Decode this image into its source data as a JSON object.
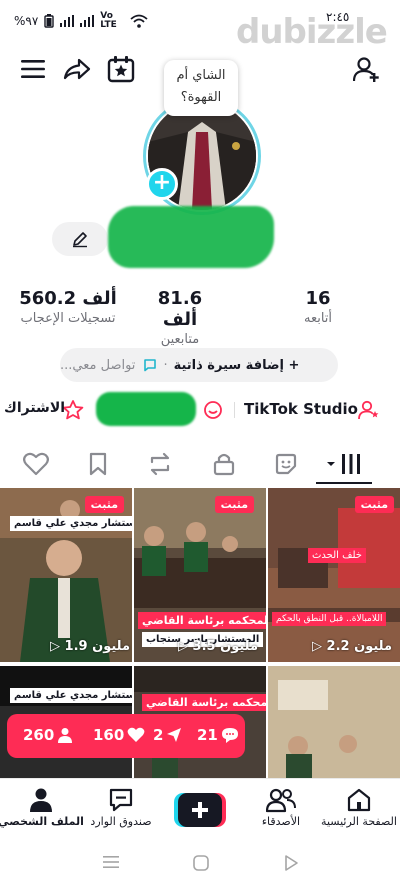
{
  "status": {
    "battery": "%٩٧",
    "network": "Vo LTE",
    "time": "٢:٤٥"
  },
  "watermark": "dubizzle",
  "profile": {
    "bubble": "الشاي أم القهوة؟",
    "stats": {
      "following": {
        "value": "16",
        "label": "أتابعه"
      },
      "followers": {
        "value": "81.6 ألف",
        "label": "متابعين"
      },
      "likes": {
        "value": "560.2 ألف",
        "label": "تسجيلات الإعجاب"
      }
    },
    "bio": {
      "add_label": "+ إضافة سيرة ذاتية",
      "contact": "تواصل معي..."
    },
    "studio_label": "TikTok Studio",
    "subscribe_label": "الاشتراك"
  },
  "videos": [
    {
      "pinned": "مثبت",
      "views": "▷ 2.2 مليون",
      "cap1": "خلف الحدث",
      "cap2": "اللامبالاة.. قبل النطق بالحكم"
    },
    {
      "pinned": "مثبت",
      "views": "▷ 3.5 مليون",
      "cap1": "المحكمه برئاسة القاضي",
      "cap2": "المستشار ياسر ستجاب"
    },
    {
      "pinned": "مثبت",
      "views": "▷ 1.9 مليون",
      "cap1": "المستشار مجدي علي قاسم"
    },
    {
      "cap1": ""
    },
    {
      "cap1": "المحكمه برئاسة القاضي"
    },
    {
      "cap1": "المستشار مجدي علي قاسم"
    }
  ],
  "float_stats": {
    "comments": "21",
    "shares": "2",
    "likes": "160",
    "followers": "260"
  },
  "nav": {
    "home": "الصفحة الرئيسية",
    "friends": "الأصدقاء",
    "inbox": "صندوق الوارد",
    "profile": "الملف الشخصي"
  },
  "colors": {
    "accent": "#fe2c55",
    "cyan": "#20d5ec",
    "redaction": "#15b54a"
  }
}
